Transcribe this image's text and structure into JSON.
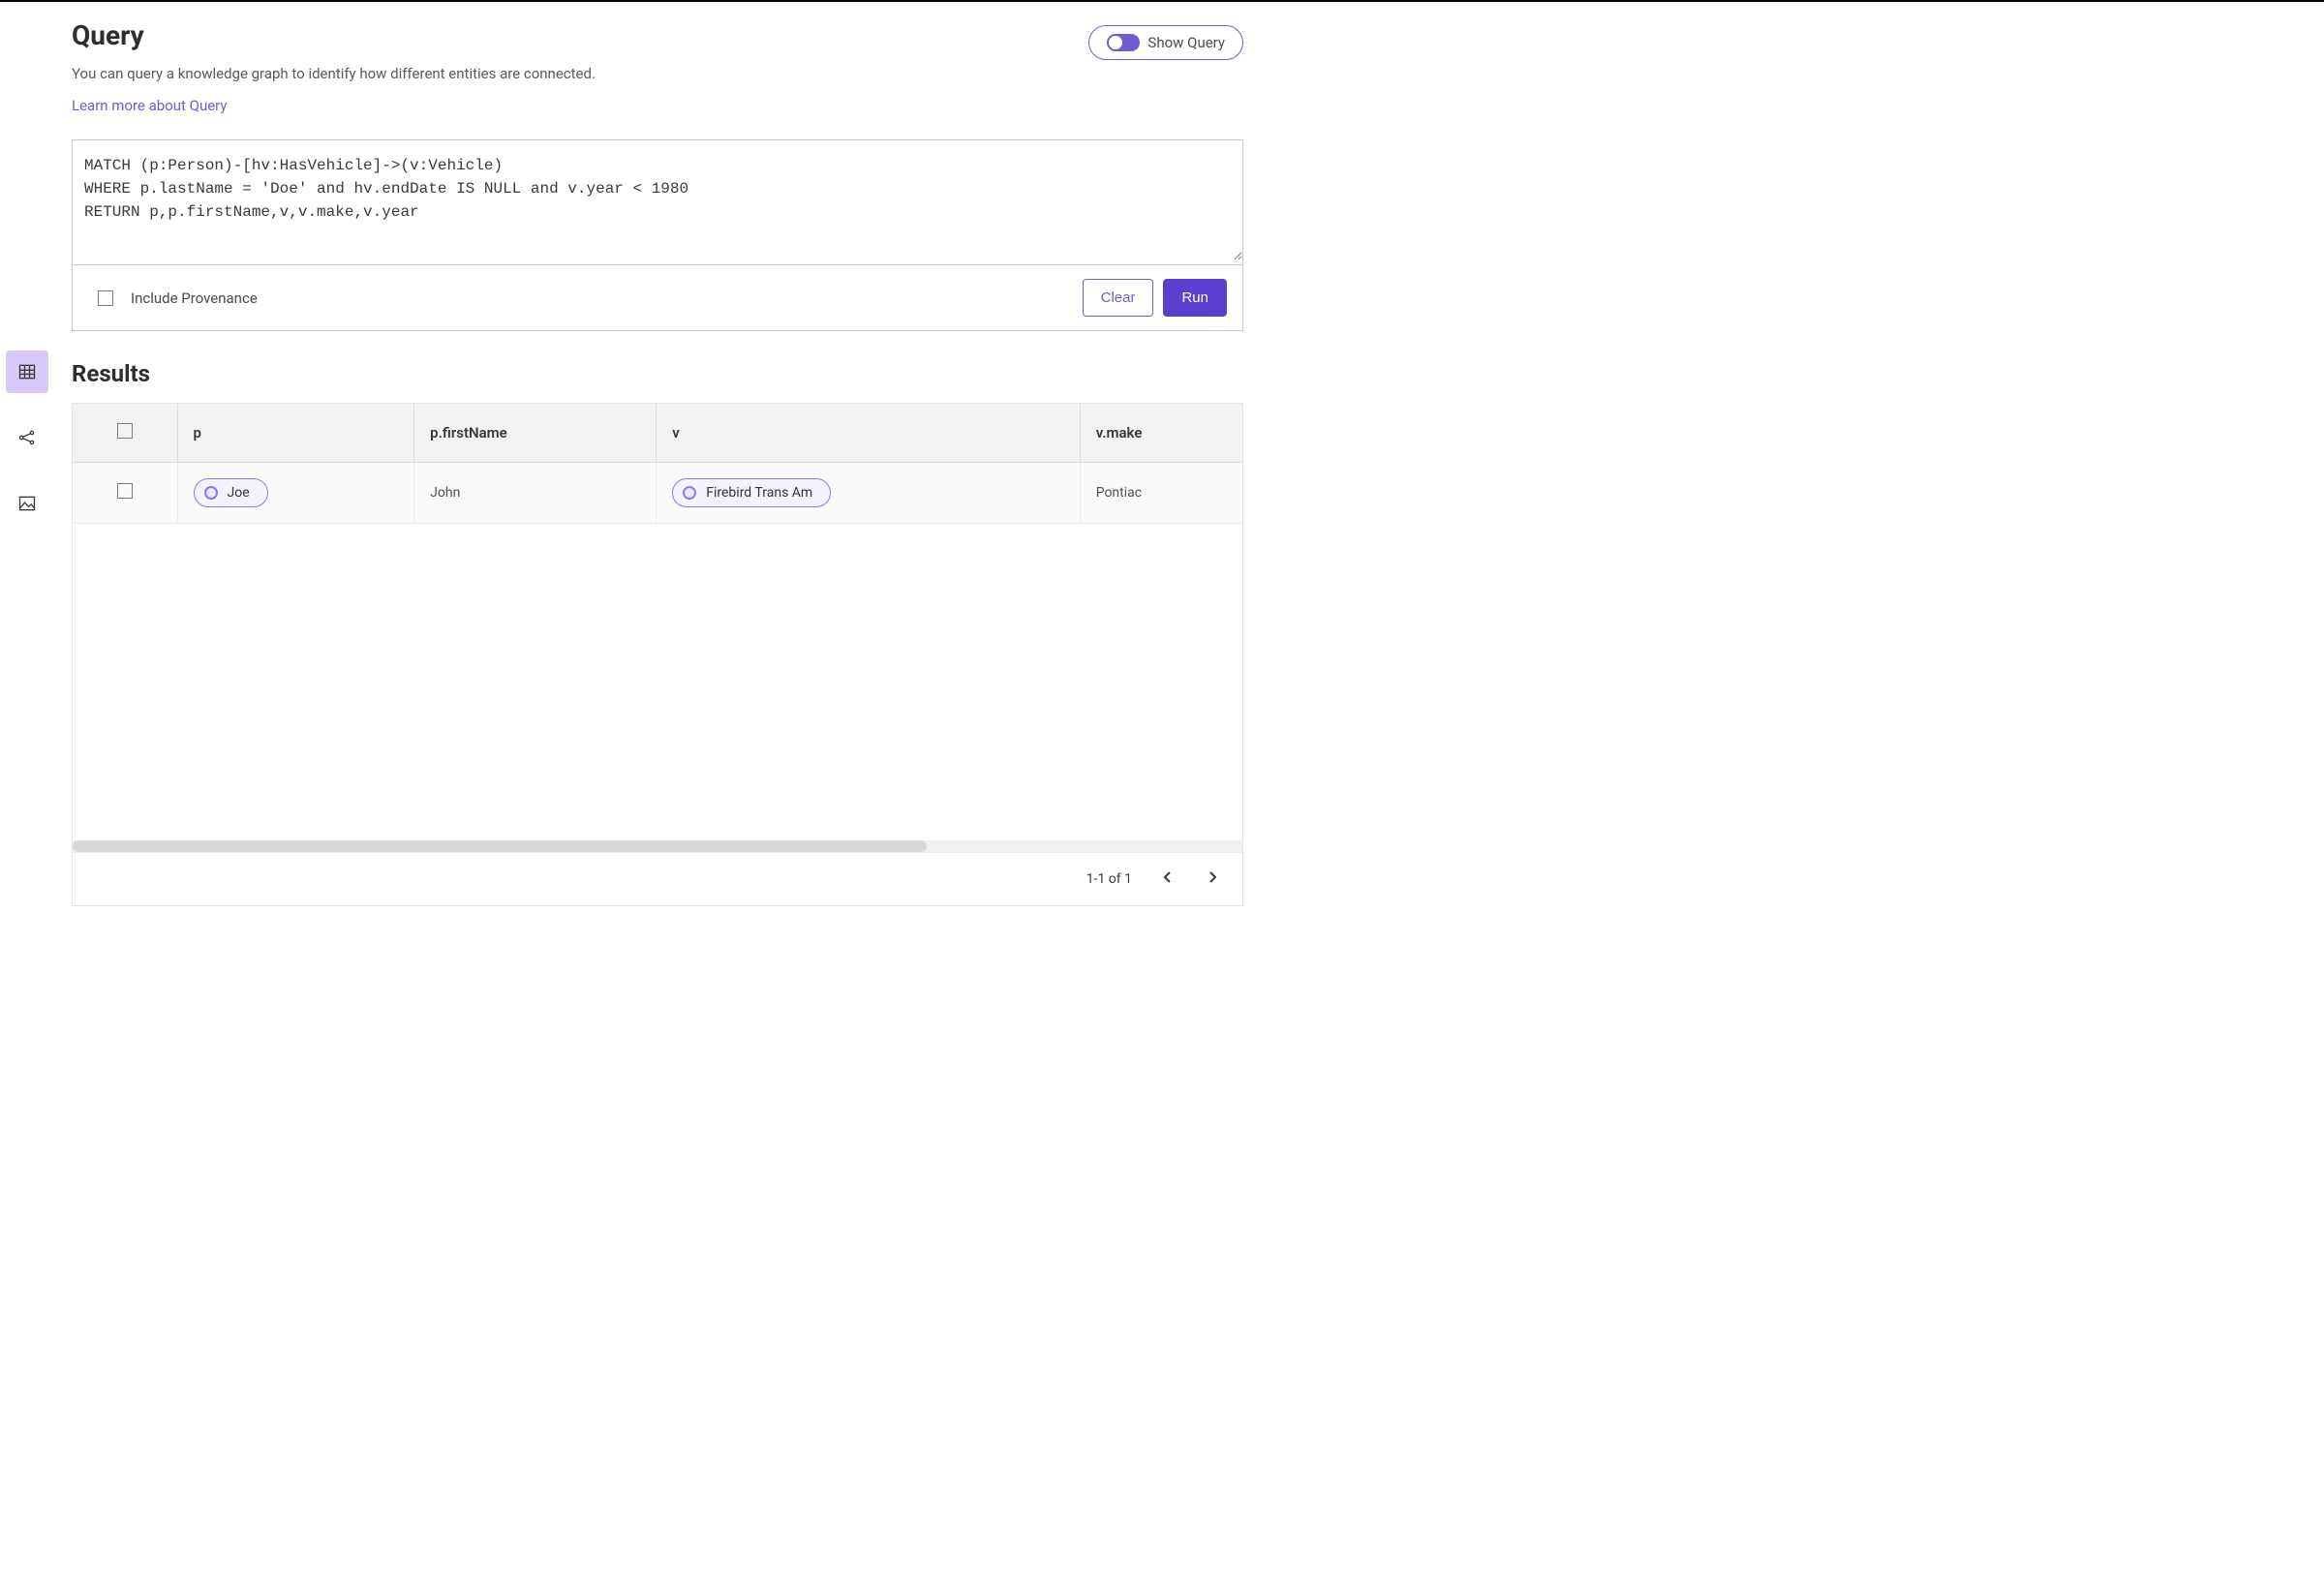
{
  "header": {
    "title": "Query",
    "subtitle": "You can query a knowledge graph to identify how different entities are connected.",
    "learn_link": "Learn more about Query",
    "toggle_label": "Show Query"
  },
  "query": {
    "text": "MATCH (p:Person)-[hv:HasVehicle]->(v:Vehicle)\nWHERE p.lastName = 'Doe' and hv.endDate IS NULL and v.year < 1980\nRETURN p,p.firstName,v,v.make,v.year",
    "include_provenance_label": "Include Provenance",
    "clear_label": "Clear",
    "run_label": "Run"
  },
  "results": {
    "title": "Results",
    "columns": {
      "c0": "p",
      "c1": "p.firstName",
      "c2": "v",
      "c3": "v.make"
    },
    "rows": [
      {
        "p_entity": "Joe",
        "p_firstName": "John",
        "v_entity": "Firebird Trans Am",
        "v_make": "Pontiac"
      }
    ],
    "pagination_label": "1-1 of 1"
  },
  "sidebar_icons": {
    "table": "table-view",
    "graph": "graph-view",
    "image": "image-view"
  }
}
